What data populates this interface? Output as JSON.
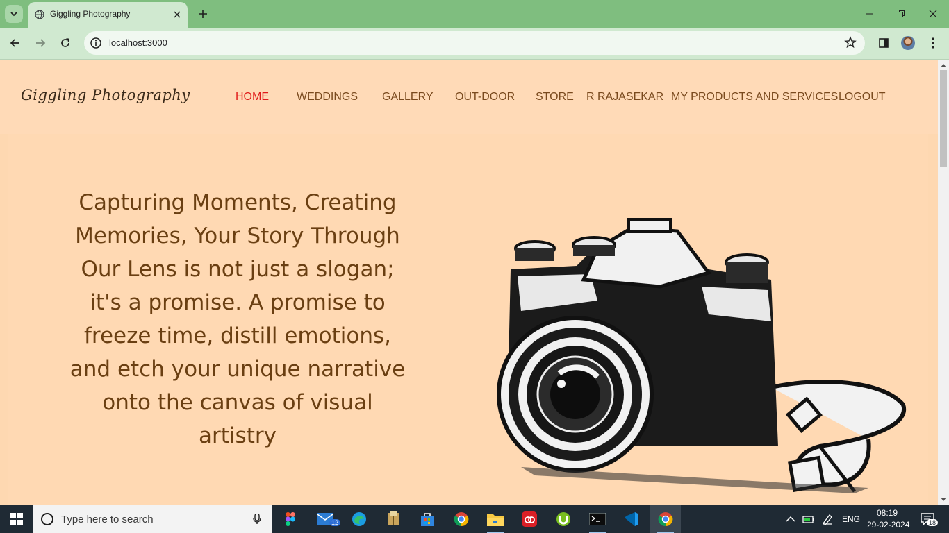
{
  "browser": {
    "tab_title": "Giggling Photography",
    "url": "localhost:3000"
  },
  "site": {
    "logo": "Giggling Photography",
    "nav": [
      "HOME",
      "WEDDINGS",
      "GALLERY",
      "OUT-DOOR",
      "STORE",
      "R RAJASEKAR",
      "MY PRODUCTS AND SERVICES",
      "LOGOUT"
    ],
    "active_nav": "HOME",
    "hero_text": "Capturing Moments, Creating Memories, Your Story Through Our Lens is not just a slogan; it's a promise. A promise to freeze time, distill emotions, and etch your unique narrative onto the canvas of visual artistry",
    "colors": {
      "background": "#fed8b1",
      "nav_text": "#7a4a1e",
      "nav_active": "#e01b1b",
      "hero_text": "#6a3f12"
    }
  },
  "taskbar": {
    "search_placeholder": "Type here to search",
    "apps": [
      "figma",
      "mail",
      "edge",
      "file-manager",
      "store",
      "chrome",
      "file-explorer",
      "creative-cloud",
      "utorrent",
      "terminal",
      "vscode",
      "chrome-active"
    ],
    "mail_badge": "12",
    "language": "ENG",
    "time": "08:19",
    "date": "29-02-2024",
    "notification_count": "18"
  }
}
